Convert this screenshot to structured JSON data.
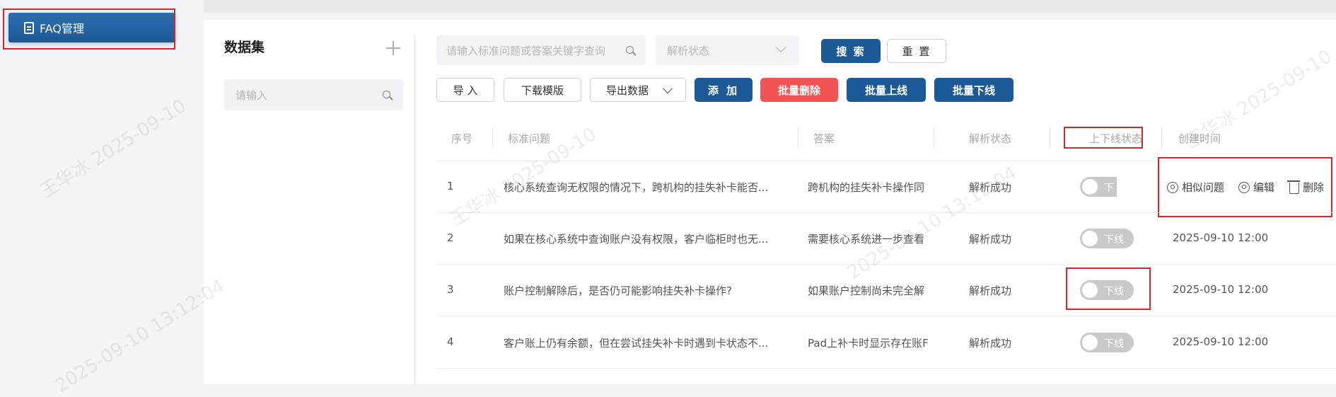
{
  "sidebar": {
    "faq_label": "FAQ管理"
  },
  "dataset": {
    "title": "数据集",
    "search_placeholder": "请输入"
  },
  "filters": {
    "keyword_placeholder": "请输入标准问题或答案关键字查询",
    "status_placeholder": "解析状态",
    "search_label": "搜 索",
    "reset_label": "重 置"
  },
  "toolbar": {
    "import": "导 入",
    "download_template": "下载模版",
    "export": "导出数据",
    "add": "添 加",
    "batch_delete": "批量删除",
    "batch_online": "批量上线",
    "batch_offline": "批量下线"
  },
  "table": {
    "headers": [
      "序号",
      "标准问题",
      "答案",
      "解析状态",
      "上下线状态",
      "创建时间"
    ],
    "rows": [
      {
        "no": "1",
        "question": "核心系统查询无权限的情况下，跨机构的挂失补卡能否...",
        "answer": "跨机构的挂失补卡操作同",
        "parse_status": "解析成功",
        "online_status": "下",
        "created": ""
      },
      {
        "no": "2",
        "question": "如果在核心系统中查询账户没有权限，客户临柜时也无...",
        "answer": "需要核心系统进一步查看",
        "parse_status": "解析成功",
        "online_status": "下线",
        "created": "2025-09-10 12:00"
      },
      {
        "no": "3",
        "question": "账户控制解除后，是否仍可能影响挂失补卡操作?",
        "answer": "如果账户控制尚未完全解",
        "parse_status": "解析成功",
        "online_status": "下线",
        "created": "2025-09-10 12:00"
      },
      {
        "no": "4",
        "question": "客户账上仍有余额，但在尝试挂失补卡时遇到卡状态不...",
        "answer": "Pad上补卡时显示存在账F",
        "parse_status": "解析成功",
        "online_status": "下线",
        "created": "2025-09-10 12:00"
      }
    ],
    "actions": {
      "similar": "相似问题",
      "edit": "编辑",
      "delete": "删除"
    }
  },
  "watermark": {
    "name": "王华冰",
    "date": "2025-09-10",
    "time": "13:12:04"
  },
  "colors": {
    "primary": "#1b5a96",
    "danger": "#f25454",
    "highlight": "#d8262d"
  }
}
